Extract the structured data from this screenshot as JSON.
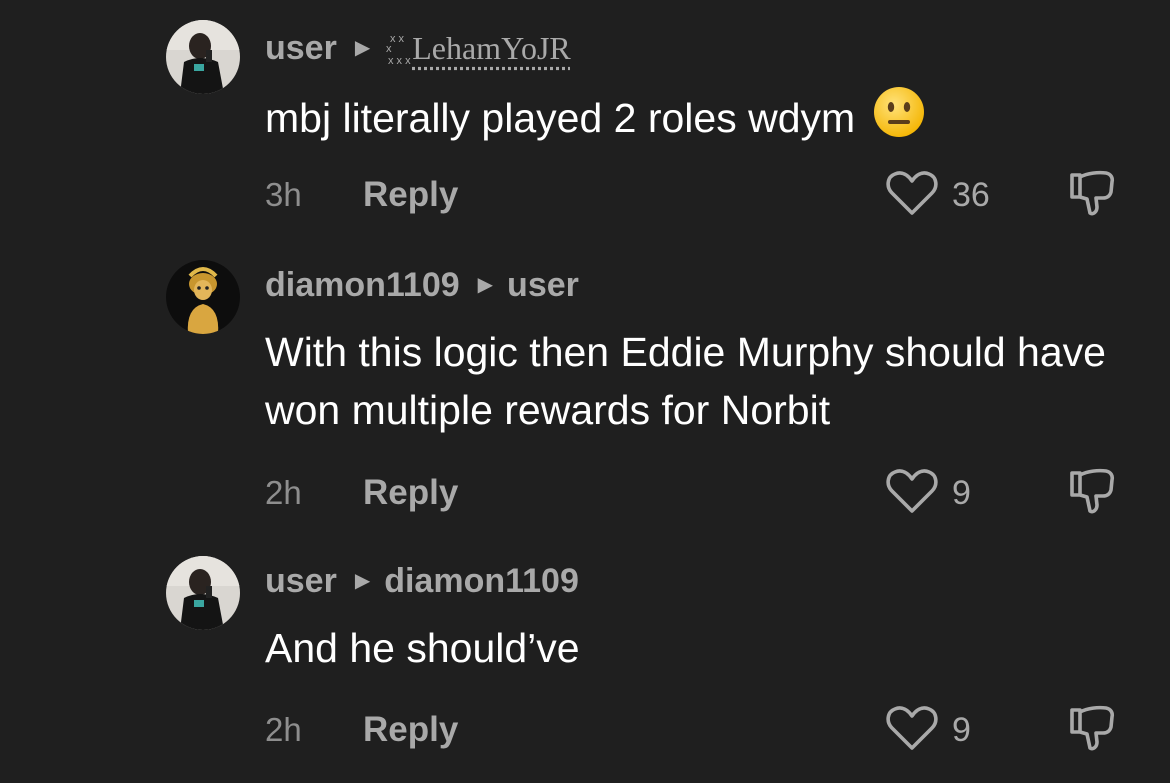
{
  "comments": [
    {
      "author": "user",
      "reply_to": "LehamYoJR",
      "text": "mbj literally played 2 roles wdym",
      "emoji": "neutral-face",
      "time": "3h",
      "reply_label": "Reply",
      "likes": "36"
    },
    {
      "author": "diamon1109",
      "reply_to": "user",
      "text": "With this logic then Eddie Murphy should have won multiple rewards for Norbit",
      "time": "2h",
      "reply_label": "Reply",
      "likes": "9"
    },
    {
      "author": "user",
      "reply_to": "diamon1109",
      "text": "And he should’ve",
      "time": "2h",
      "reply_label": "Reply",
      "likes": "9"
    }
  ],
  "icons": {
    "reply_arrow": "caret-right-icon",
    "like": "heart-icon",
    "dislike": "thumbs-down-icon"
  },
  "colors": {
    "background": "#1f1f1f",
    "primary_text": "#ffffff",
    "secondary_text": "#a9a9a9"
  }
}
